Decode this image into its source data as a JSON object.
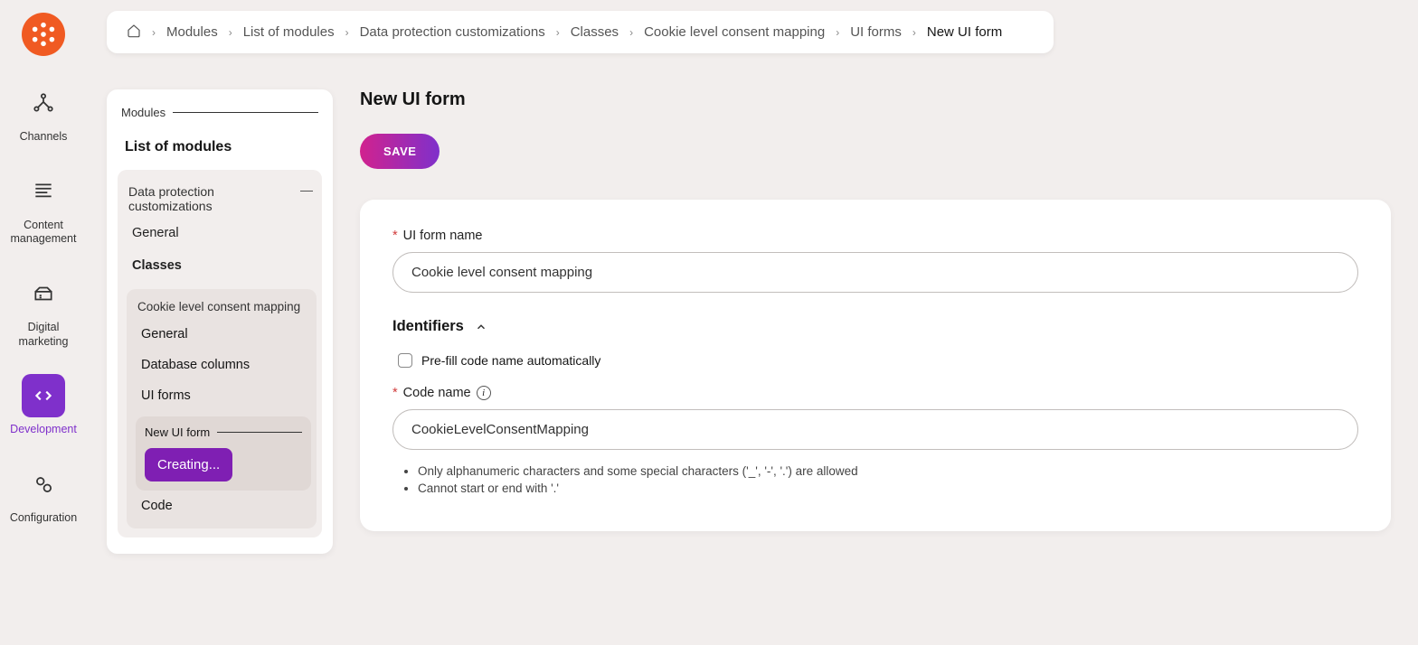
{
  "nav": {
    "items": [
      {
        "label": "Channels"
      },
      {
        "label": "Content management"
      },
      {
        "label": "Digital marketing"
      },
      {
        "label": "Development"
      },
      {
        "label": "Configuration"
      }
    ]
  },
  "breadcrumb": {
    "items": [
      "Modules",
      "List of modules",
      "Data protection customizations",
      "Classes",
      "Cookie level consent mapping",
      "UI forms",
      "New UI form"
    ]
  },
  "sidepanel": {
    "heading": "Modules",
    "list_of_modules": "List of modules",
    "data_protection": "Data protection customizations",
    "general": "General",
    "classes": "Classes",
    "cookie_level": "Cookie level consent mapping",
    "inner_general": "General",
    "database_columns": "Database columns",
    "ui_forms": "UI forms",
    "new_ui_form": "New UI form",
    "creating": "Creating...",
    "code": "Code"
  },
  "page": {
    "title": "New UI form",
    "save": "SAVE"
  },
  "form": {
    "ui_form_name_label": "UI form name",
    "ui_form_name_value": "Cookie level consent mapping",
    "identifiers_header": "Identifiers",
    "prefill_label": "Pre-fill code name automatically",
    "code_name_label": "Code name",
    "code_name_value": "CookieLevelConsentMapping",
    "hint1": "Only alphanumeric characters and some special characters ('_', '-', '.') are allowed",
    "hint2": "Cannot start or end with '.'"
  }
}
